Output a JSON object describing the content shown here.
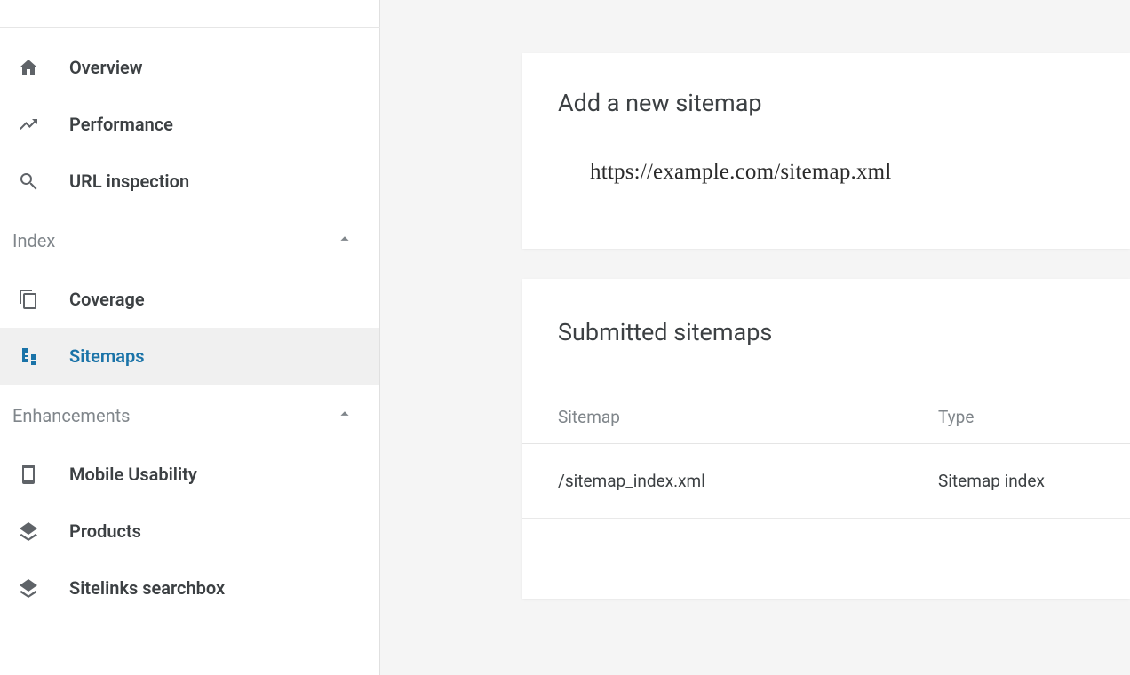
{
  "sidebar": {
    "top_items": [
      {
        "id": "overview",
        "icon": "home-icon",
        "label": "Overview"
      },
      {
        "id": "performance",
        "icon": "trending-icon",
        "label": "Performance"
      },
      {
        "id": "url-inspection",
        "icon": "search-icon",
        "label": "URL inspection"
      }
    ],
    "sections": [
      {
        "id": "index",
        "label": "Index",
        "expanded": true,
        "items": [
          {
            "id": "coverage",
            "icon": "copy-icon",
            "label": "Coverage"
          },
          {
            "id": "sitemaps",
            "icon": "sitemap-icon",
            "label": "Sitemaps",
            "active": true
          }
        ]
      },
      {
        "id": "enhancements",
        "label": "Enhancements",
        "expanded": true,
        "items": [
          {
            "id": "mobile-usability",
            "icon": "phone-icon",
            "label": "Mobile Usability"
          },
          {
            "id": "products",
            "icon": "layers-icon",
            "label": "Products"
          },
          {
            "id": "sitelinks-searchbox",
            "icon": "layers-icon",
            "label": "Sitelinks searchbox"
          }
        ]
      }
    ]
  },
  "main": {
    "add_card": {
      "title": "Add a new sitemap",
      "url_value": "https://example.com/sitemap.xml"
    },
    "submitted_card": {
      "title": "Submitted sitemaps",
      "columns": {
        "sitemap": "Sitemap",
        "type": "Type"
      },
      "rows": [
        {
          "sitemap": "/sitemap_index.xml",
          "type": "Sitemap index"
        }
      ]
    }
  }
}
